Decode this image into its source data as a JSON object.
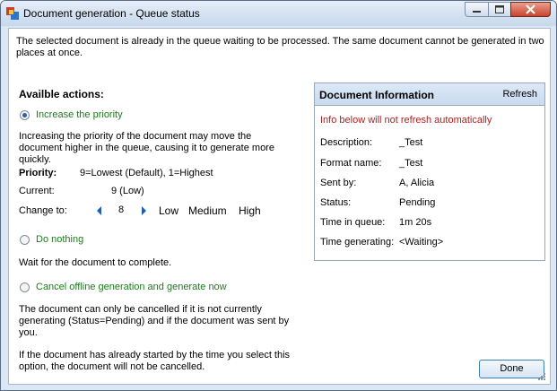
{
  "window": {
    "title": "Document generation - Queue status"
  },
  "message": "The selected document is already in the queue waiting to be processed.  The same document cannot be generated  in two places at once.",
  "actions": {
    "heading": "Availble actions:",
    "increase": {
      "label": "Increase the priority",
      "description": "Increasing the priority of the document may move the document higher in the queue, causing it to generate more quickly.",
      "priority_label": "Priority:",
      "priority_hint": "9=Lowest (Default), 1=Highest",
      "current_label": "Current:",
      "current_value": "9 (Low)",
      "change_label": "Change to:",
      "change_value": "8",
      "presets": [
        "Low",
        "Medium",
        "High"
      ]
    },
    "nothing": {
      "label": "Do nothing",
      "description": "Wait for the document to complete."
    },
    "cancel": {
      "label": "Cancel offline generation and generate now",
      "description1": "The document can only be cancelled if it is not currently generating (Status=Pending) and if the document was sent by you.",
      "description2": "If the document has already started by the time you select this option, the document will not be cancelled."
    }
  },
  "info": {
    "title": "Document Information",
    "refresh": "Refresh",
    "warning": "Info below will not refresh automatically",
    "rows": [
      {
        "label": "Description:",
        "value": "_Test"
      },
      {
        "label": "Format name:",
        "value": "_Test"
      },
      {
        "label": "Sent by:",
        "value": "A, Alicia"
      },
      {
        "label": "Status:",
        "value": "Pending"
      },
      {
        "label": "Time in queue:",
        "value": "1m 20s"
      },
      {
        "label": "Time generating:",
        "value": "<Waiting>"
      }
    ]
  },
  "done_label": "Done",
  "colors": {
    "accent_text": "#1a7d1a",
    "warning_text": "#b41c1c",
    "titlebar": "#c7d8ec"
  }
}
